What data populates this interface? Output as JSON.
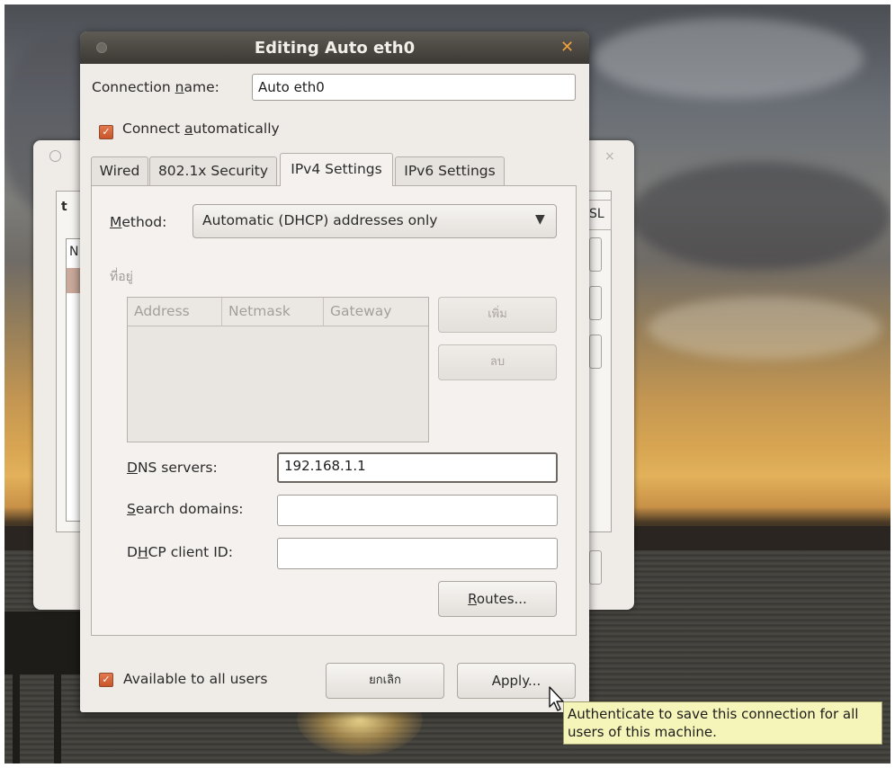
{
  "dialog": {
    "title": "Editing Auto eth0",
    "connection_name_label_pre": "Connection ",
    "connection_name_label_u": "n",
    "connection_name_label_post": "ame:",
    "connection_name_value": "Auto eth0",
    "connect_auto_pre": "Connect ",
    "connect_auto_u": "a",
    "connect_auto_post": "utomatically",
    "connect_auto_checked": true
  },
  "tabs": [
    {
      "label": "Wired"
    },
    {
      "label": "802.1x Security"
    },
    {
      "label": "IPv4 Settings"
    },
    {
      "label": "IPv6 Settings"
    }
  ],
  "ipv4": {
    "method_label_u": "M",
    "method_label_post": "ethod:",
    "method_value": "Automatic (DHCP) addresses only",
    "addresses_label": "ที่อยู่",
    "columns": [
      "Address",
      "Netmask",
      "Gateway"
    ],
    "add_button": "เพิ่ม",
    "delete_button": "ลบ",
    "dns_label_u": "D",
    "dns_label_post": "NS servers:",
    "dns_value": "192.168.1.1",
    "search_label_u": "S",
    "search_label_post": "earch domains:",
    "search_value": "",
    "dhcp_label_pre": "D",
    "dhcp_label_u": "H",
    "dhcp_label_post": "CP client ID:",
    "dhcp_value": "",
    "routes_u": "R",
    "routes_post": "outes..."
  },
  "footer": {
    "available_label": "Available to all users",
    "available_checked": true,
    "cancel_button": "ยกเลิก",
    "apply_button": "Apply..."
  },
  "tooltip": {
    "text": "Authenticate to save this connection for all users of this machine."
  },
  "background_window": {
    "partial_tab": "SL",
    "partial_label": "t",
    "partial_col": "N"
  },
  "colors": {
    "checkbox": "#d9663b",
    "close_button": "#f0a23a",
    "titlebar": "#4a4640",
    "tooltip_bg": "#f6f5b9"
  }
}
